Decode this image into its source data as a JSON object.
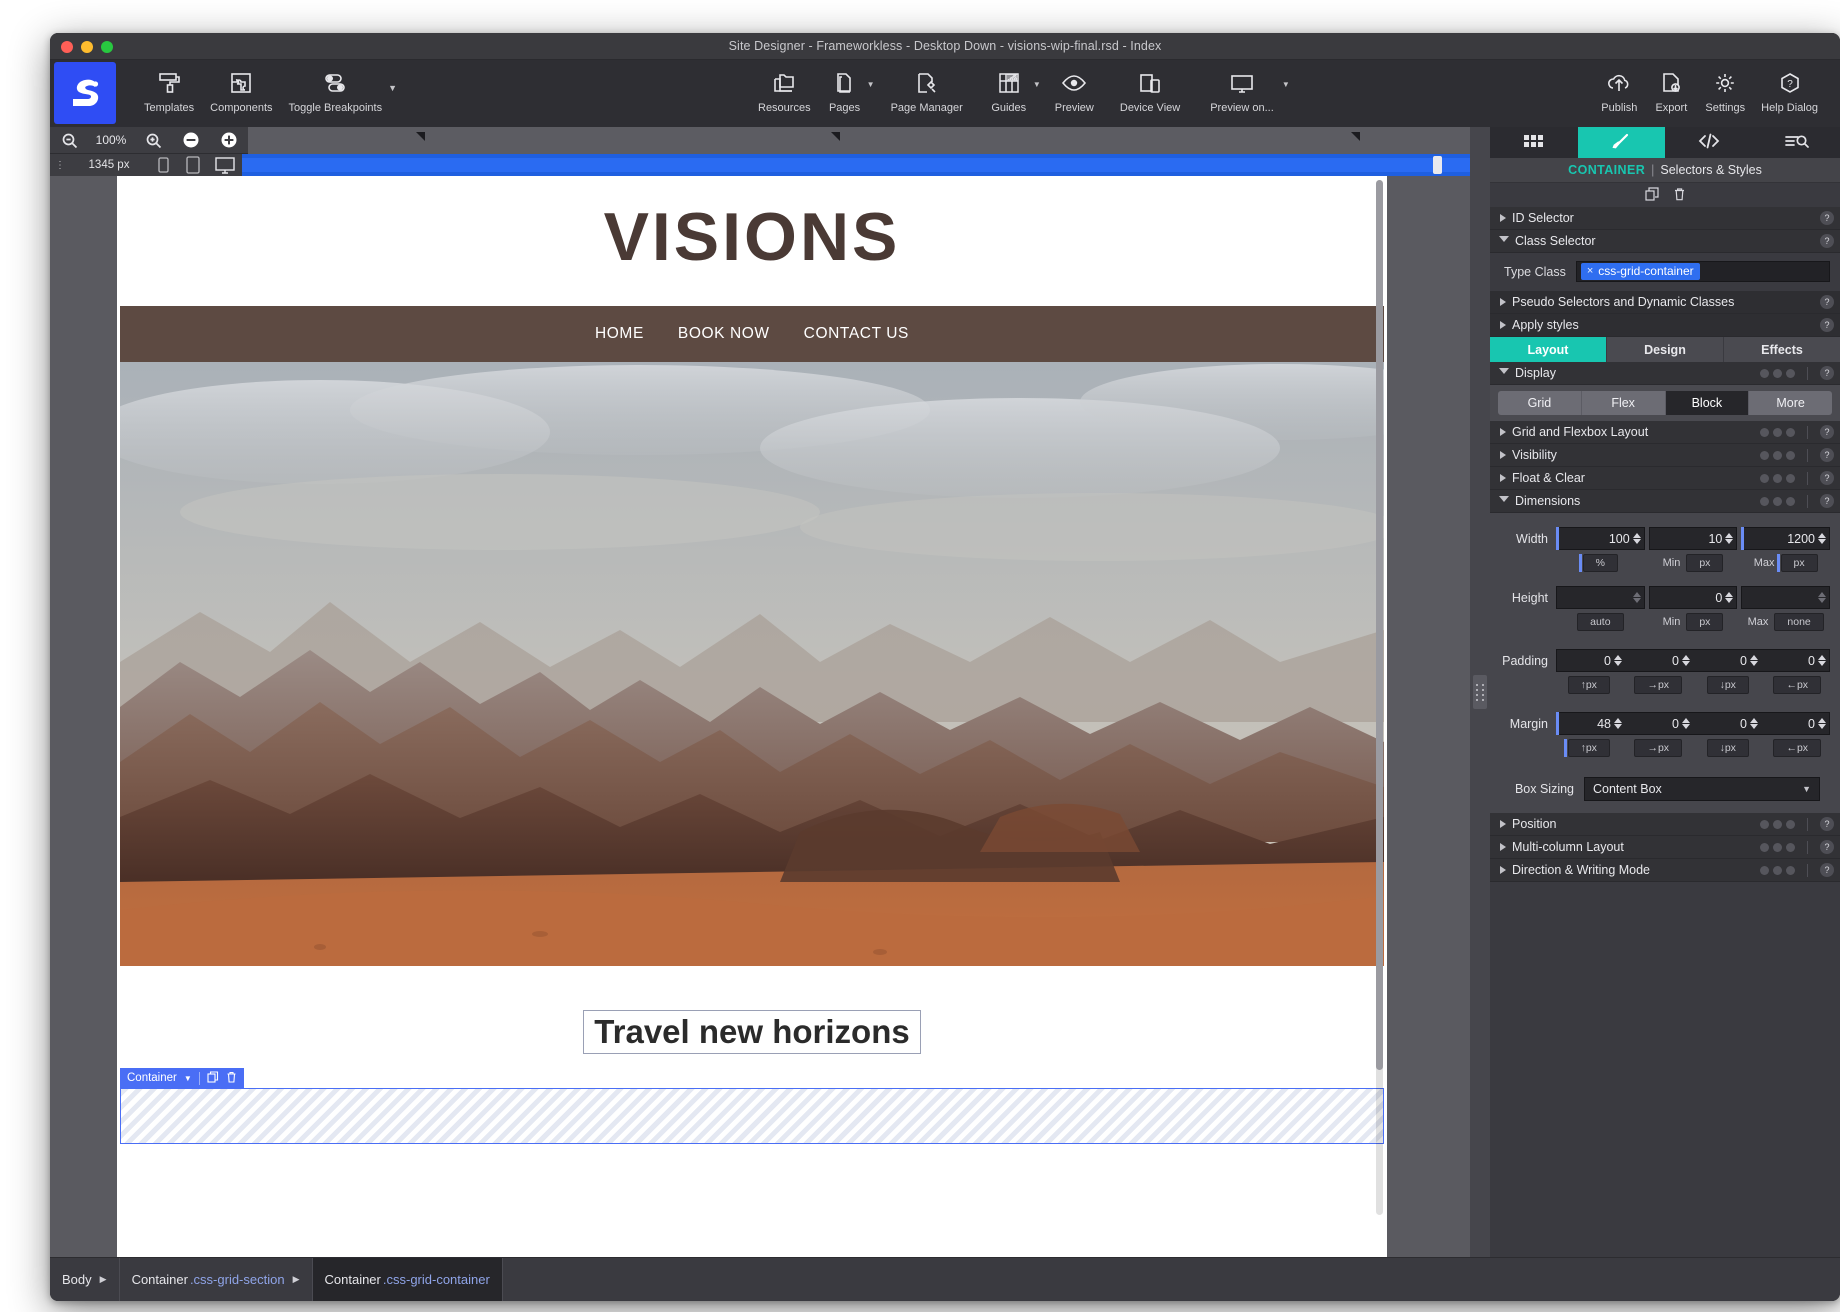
{
  "window": {
    "title": "Site Designer - Frameworkless - Desktop Down - visions-wip-final.rsd - Index"
  },
  "toolbar": {
    "left": [
      {
        "label": "Templates",
        "icon": "paint-roller-icon"
      },
      {
        "label": "Components",
        "icon": "puzzle-icon"
      },
      {
        "label": "Toggle Breakpoints",
        "icon": "toggles-icon",
        "caret": true
      }
    ],
    "center": [
      {
        "label": "Resources",
        "icon": "folders-icon"
      },
      {
        "label": "Pages",
        "icon": "pages-icon",
        "caret": true
      },
      {
        "label": "Page Manager",
        "icon": "page-manager-icon"
      },
      {
        "label": "Guides",
        "icon": "guides-grid-icon",
        "caret": true
      },
      {
        "label": "Preview",
        "icon": "eye-icon"
      },
      {
        "label": "Device View",
        "icon": "devices-icon"
      },
      {
        "label": "Preview on...",
        "icon": "monitor-icon",
        "caret": true
      }
    ],
    "right": [
      {
        "label": "Publish",
        "icon": "cloud-upload-icon"
      },
      {
        "label": "Export",
        "icon": "file-export-icon"
      },
      {
        "label": "Settings",
        "icon": "gear-icon"
      },
      {
        "label": "Help Dialog",
        "icon": "help-hex-icon"
      }
    ]
  },
  "zoombar": {
    "zoom_out_icon": "zoom-out-icon",
    "zoom_level": "100%",
    "zoom_in_icon": "zoom-in-icon",
    "minus_icon": "minus-circle-icon",
    "plus_icon": "plus-circle-icon"
  },
  "breakpoint_bar": {
    "grip_icon": "drag-grip-icon",
    "width_value": "1345 px",
    "devices": [
      "phone-icon",
      "tablet-icon",
      "desktop-icon"
    ]
  },
  "canvas": {
    "site_title": "VISIONS",
    "nav": [
      "HOME",
      "BOOK NOW",
      "CONTACT US"
    ],
    "subhead": "Travel new horizons",
    "selection_badge": {
      "label": "Container",
      "caret_icon": "chevron-down-icon",
      "duplicate_icon": "duplicate-icon",
      "delete_icon": "trash-icon"
    }
  },
  "inspector": {
    "tabs": [
      {
        "name": "grid-view-tab",
        "icon": "grid-tiles-icon",
        "active": false
      },
      {
        "name": "styles-tab",
        "icon": "paintbrush-icon",
        "active": true
      },
      {
        "name": "code-tab",
        "icon": "code-brackets-icon",
        "active": false
      },
      {
        "name": "find-tab",
        "icon": "list-search-icon",
        "active": false
      }
    ],
    "header": {
      "context": "CONTAINER",
      "divider": "|",
      "subtitle": "Selectors & Styles"
    },
    "actions": [
      {
        "name": "duplicate-style-icon",
        "icon": "duplicate-icon"
      },
      {
        "name": "delete-style-icon",
        "icon": "trash-icon"
      }
    ],
    "selectors": [
      {
        "label": "ID Selector",
        "open": false
      },
      {
        "label": "Class Selector",
        "open": true
      }
    ],
    "type_class": {
      "label": "Type Class",
      "tag": "css-grid-container",
      "tag_remove": "×",
      "placeholder": "Type Class"
    },
    "selector_rows": [
      {
        "label": "Pseudo Selectors and Dynamic Classes"
      },
      {
        "label": "Apply styles"
      }
    ],
    "style_tabs": [
      {
        "label": "Layout",
        "active": true
      },
      {
        "label": "Design",
        "active": false
      },
      {
        "label": "Effects",
        "active": false
      }
    ],
    "display": {
      "label": "Display",
      "options": [
        "Grid",
        "Flex",
        "Block",
        "More"
      ],
      "selected": "Block"
    },
    "sections": [
      {
        "label": "Grid and Flexbox Layout",
        "open": false
      },
      {
        "label": "Visibility",
        "open": false
      },
      {
        "label": "Float & Clear",
        "open": false
      },
      {
        "label": "Dimensions",
        "open": true
      }
    ],
    "dimensions": {
      "width": {
        "label": "Width",
        "values": [
          "100",
          "10",
          "1200"
        ],
        "units": [
          "%",
          "px",
          "px"
        ],
        "minmax": [
          "Min",
          "Max"
        ]
      },
      "height": {
        "label": "Height",
        "values": [
          "",
          "0",
          ""
        ],
        "units": [
          "auto",
          "px",
          "none"
        ],
        "minmax": [
          "Min",
          "Max"
        ]
      },
      "padding": {
        "label": "Padding",
        "values": [
          "0",
          "0",
          "0",
          "0"
        ],
        "units": [
          "↑px",
          "→px",
          "↓px",
          "←px"
        ]
      },
      "margin": {
        "label": "Margin",
        "values": [
          "48",
          "0",
          "0",
          "0"
        ],
        "units": [
          "↑px",
          "→px",
          "↓px",
          "←px"
        ]
      },
      "box_sizing": {
        "label": "Box Sizing",
        "value": "Content Box"
      }
    },
    "bottom_sections": [
      {
        "label": "Position"
      },
      {
        "label": "Multi-column Layout"
      },
      {
        "label": "Direction & Writing Mode"
      }
    ]
  },
  "breadcrumb": [
    {
      "element": "Body",
      "class": "",
      "arrow": "▶",
      "selected": false
    },
    {
      "element": "Container",
      "class": ".css-grid-section",
      "arrow": "▶",
      "selected": false
    },
    {
      "element": "Container",
      "class": ".css-grid-container",
      "arrow": "",
      "selected": true
    }
  ],
  "colors": {
    "accent_teal": "#18c6b0",
    "accent_blue": "#2f6ef0",
    "logo_blue": "#2f4df4",
    "nav_brown": "#5d4a42",
    "title_brown": "#4a3a35"
  }
}
